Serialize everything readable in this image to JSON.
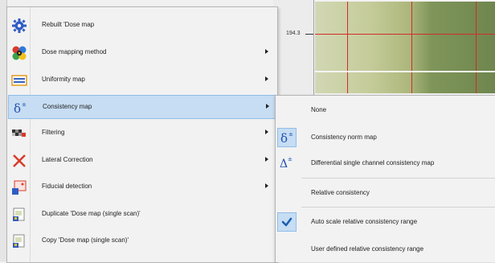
{
  "dose_map_view": {
    "ruler_value": "194.3"
  },
  "menu": {
    "items": [
      {
        "label": "Rebuilt 'Dose map",
        "icon": "gear-icon",
        "has_submenu": false
      },
      {
        "label": "Dose mapping method",
        "icon": "radiation-icon",
        "has_submenu": true
      },
      {
        "label": "Uniformity map",
        "icon": "uniformity-icon",
        "has_submenu": true
      },
      {
        "label": "Consistency map",
        "icon": "delta-icon",
        "has_submenu": true,
        "highlighted": true
      },
      {
        "label": "Filtering",
        "icon": "filter-icon",
        "has_submenu": true
      },
      {
        "label": "Lateral Correction",
        "icon": "cross-icon",
        "has_submenu": true
      },
      {
        "label": "Fiducial detection",
        "icon": "fiducial-icon",
        "has_submenu": true
      },
      {
        "label": "Duplicate 'Dose map (single scan)'",
        "icon": "duplicate-icon",
        "has_submenu": false
      },
      {
        "label": "Copy 'Dose map (single scan)'",
        "icon": "copy-icon",
        "has_submenu": false
      }
    ]
  },
  "submenu": {
    "items": [
      {
        "label": "None"
      },
      {
        "label": "Consistency norm map",
        "icon": "delta-icon",
        "selected": true
      },
      {
        "label": "Differential single channel consistency map",
        "icon": "capital-delta-icon"
      },
      {
        "label": "Relative consistency"
      },
      {
        "label": "Auto scale relative consistency range",
        "checked": true
      },
      {
        "label": "User defined relative consistency range"
      }
    ]
  },
  "colors": {
    "highlight": "#c6ddf3",
    "highlight_border": "#90bde8",
    "menu_background": "#f2f2f2",
    "delta_icon": "#1f4fb0",
    "check_icon": "#1a5fb4"
  }
}
